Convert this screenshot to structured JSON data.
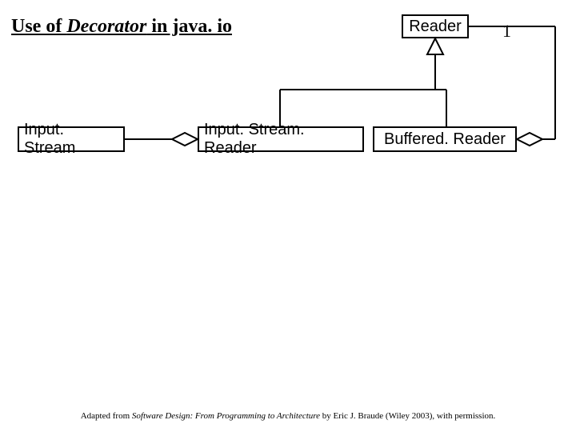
{
  "title": {
    "prefix": "Use of ",
    "keyword": "Decorator",
    "suffix": " in java. io"
  },
  "boxes": {
    "reader": "Reader",
    "inputstream": "Input. Stream",
    "inputstreamreader": "Input. Stream. Reader",
    "bufferedreader": "Buffered. Reader"
  },
  "multiplicity": "1",
  "caption": {
    "prefix": "Adapted from ",
    "book": "Software Design: From Programming to Architecture",
    "suffix": " by Eric J. Braude (Wiley 2003), with permission."
  }
}
